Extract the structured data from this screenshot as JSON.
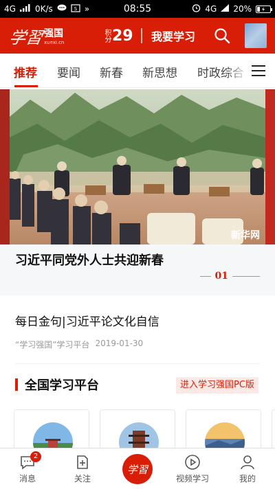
{
  "status_bar": {
    "network": "4G",
    "speed": "0K/s",
    "time": "08:55",
    "network_right": "4G",
    "battery": "20%"
  },
  "header": {
    "logo_mark": "学習",
    "logo_cn": "强国",
    "logo_en": "xuexi.cn",
    "points_label": "积分",
    "points_value": "29",
    "study_label": "我要学习"
  },
  "tabs": [
    {
      "label": "推荐",
      "active": true
    },
    {
      "label": "要闻",
      "active": false
    },
    {
      "label": "新春",
      "active": false
    },
    {
      "label": "新思想",
      "active": false
    },
    {
      "label": "时政综合",
      "active": false
    }
  ],
  "hero": {
    "watermark": "新华网",
    "title": "习近平同党外人士共迎新春",
    "page_num": "01"
  },
  "article": {
    "title": "每日金句|习近平论文化自信",
    "source": "“学习强国”学习平台",
    "date": "2019-01-30"
  },
  "section": {
    "title": "全国学习平台",
    "pc_button": "进入学习强国PC版"
  },
  "bottom_nav": {
    "messages_label": "消息",
    "messages_badge": "2",
    "follow_label": "关注",
    "center_label": "学習",
    "video_label": "视频学习",
    "mine_label": "我的"
  },
  "colors": {
    "brand_red": "#d81e06"
  }
}
